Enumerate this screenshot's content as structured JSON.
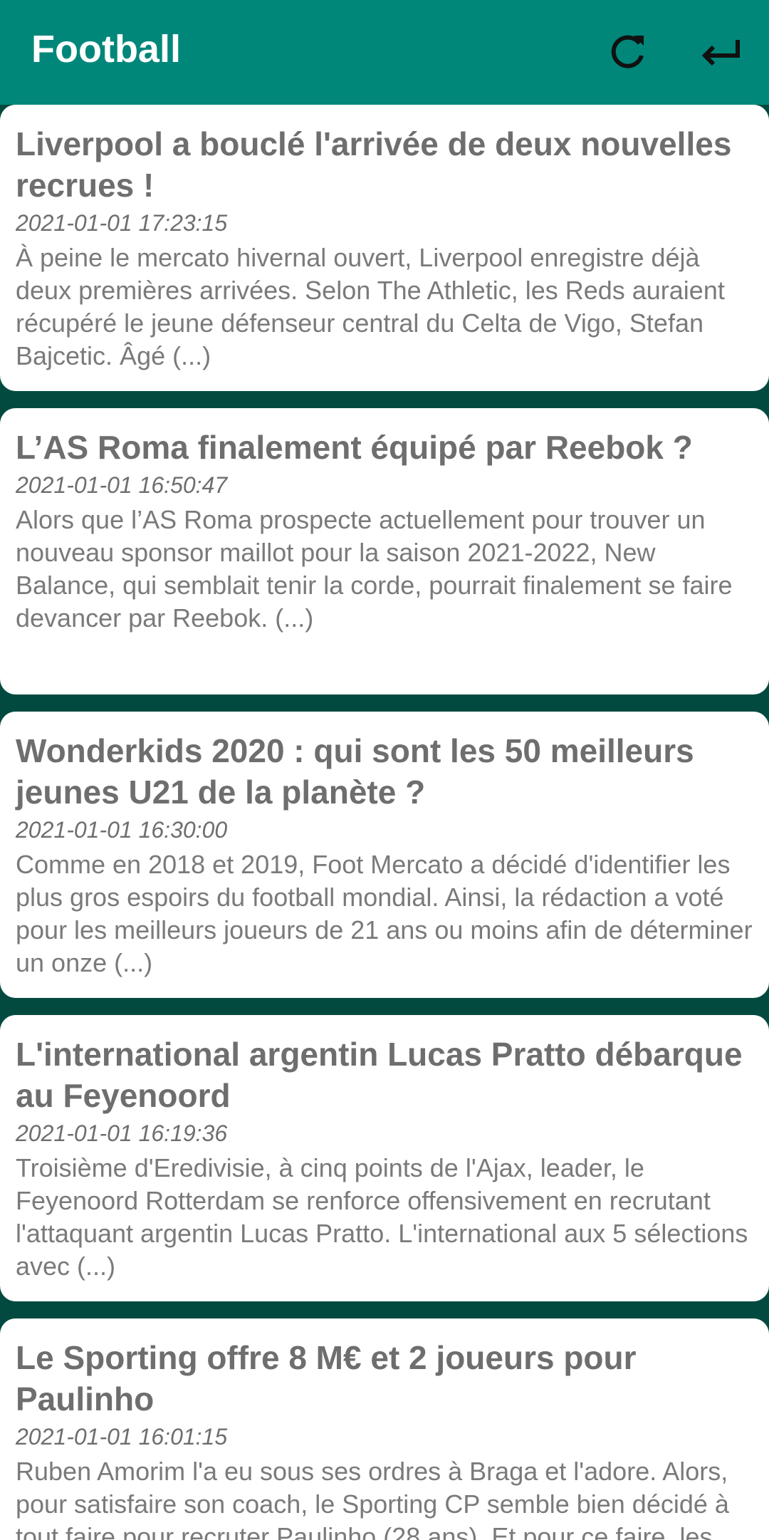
{
  "appbar": {
    "title": "Football",
    "refresh_icon": "refresh-icon",
    "back_icon": "return-arrow-icon"
  },
  "colors": {
    "appbar_bg": "#00877a",
    "page_bg": "#024a3f",
    "card_bg": "#ffffff",
    "text": "#6e6e6e"
  },
  "articles": [
    {
      "title": "Liverpool a bouclé l'arrivée de deux nouvelles recrues !",
      "date": "2021-01-01 17:23:15",
      "summary": "À peine le mercato hivernal ouvert, Liverpool enregistre déjà deux premières arrivées. Selon The Athletic, les Reds auraient récupéré le jeune défenseur central du Celta de Vigo, Stefan Bajcetic. Âgé (...)"
    },
    {
      "title": "L’AS Roma finalement équipé par Reebok ?",
      "date": "2021-01-01 16:50:47",
      "summary": "Alors que l’AS Roma prospecte actuellement pour trouver un nouveau sponsor maillot pour la saison 2021-2022, New Balance, qui semblait tenir la corde, pourrait finalement se faire devancer par Reebok. (...)"
    },
    {
      "title": "Wonderkids 2020 : qui sont les 50 meilleurs jeunes U21 de la planète ?",
      "date": "2021-01-01 16:30:00",
      "summary": "Comme en 2018 et 2019, Foot Mercato a décidé d'identifier les plus gros espoirs du football mondial. Ainsi, la rédaction a voté pour les meilleurs joueurs de 21 ans ou moins afin de déterminer un onze (...)"
    },
    {
      "title": "L'international argentin Lucas Pratto débarque au Feyenoord",
      "date": "2021-01-01 16:19:36",
      "summary": "Troisième d'Eredivisie, à cinq points de l'Ajax, leader, le Feyenoord Rotterdam se renforce offensivement en recrutant l'attaquant argentin Lucas Pratto. L'international aux 5 sélections avec (...)"
    },
    {
      "title": "Le Sporting offre 8 M€ et 2 joueurs pour Paulinho",
      "date": "2021-01-01 16:01:15",
      "summary": "Ruben Amorim l'a eu sous ses ordres à Braga et l'adore. Alors, pour satisfaire son coach, le Sporting CP semble bien décidé à tout faire pour recruter Paulinho (28 ans). Et pour ce faire, les Leões (...)"
    }
  ]
}
